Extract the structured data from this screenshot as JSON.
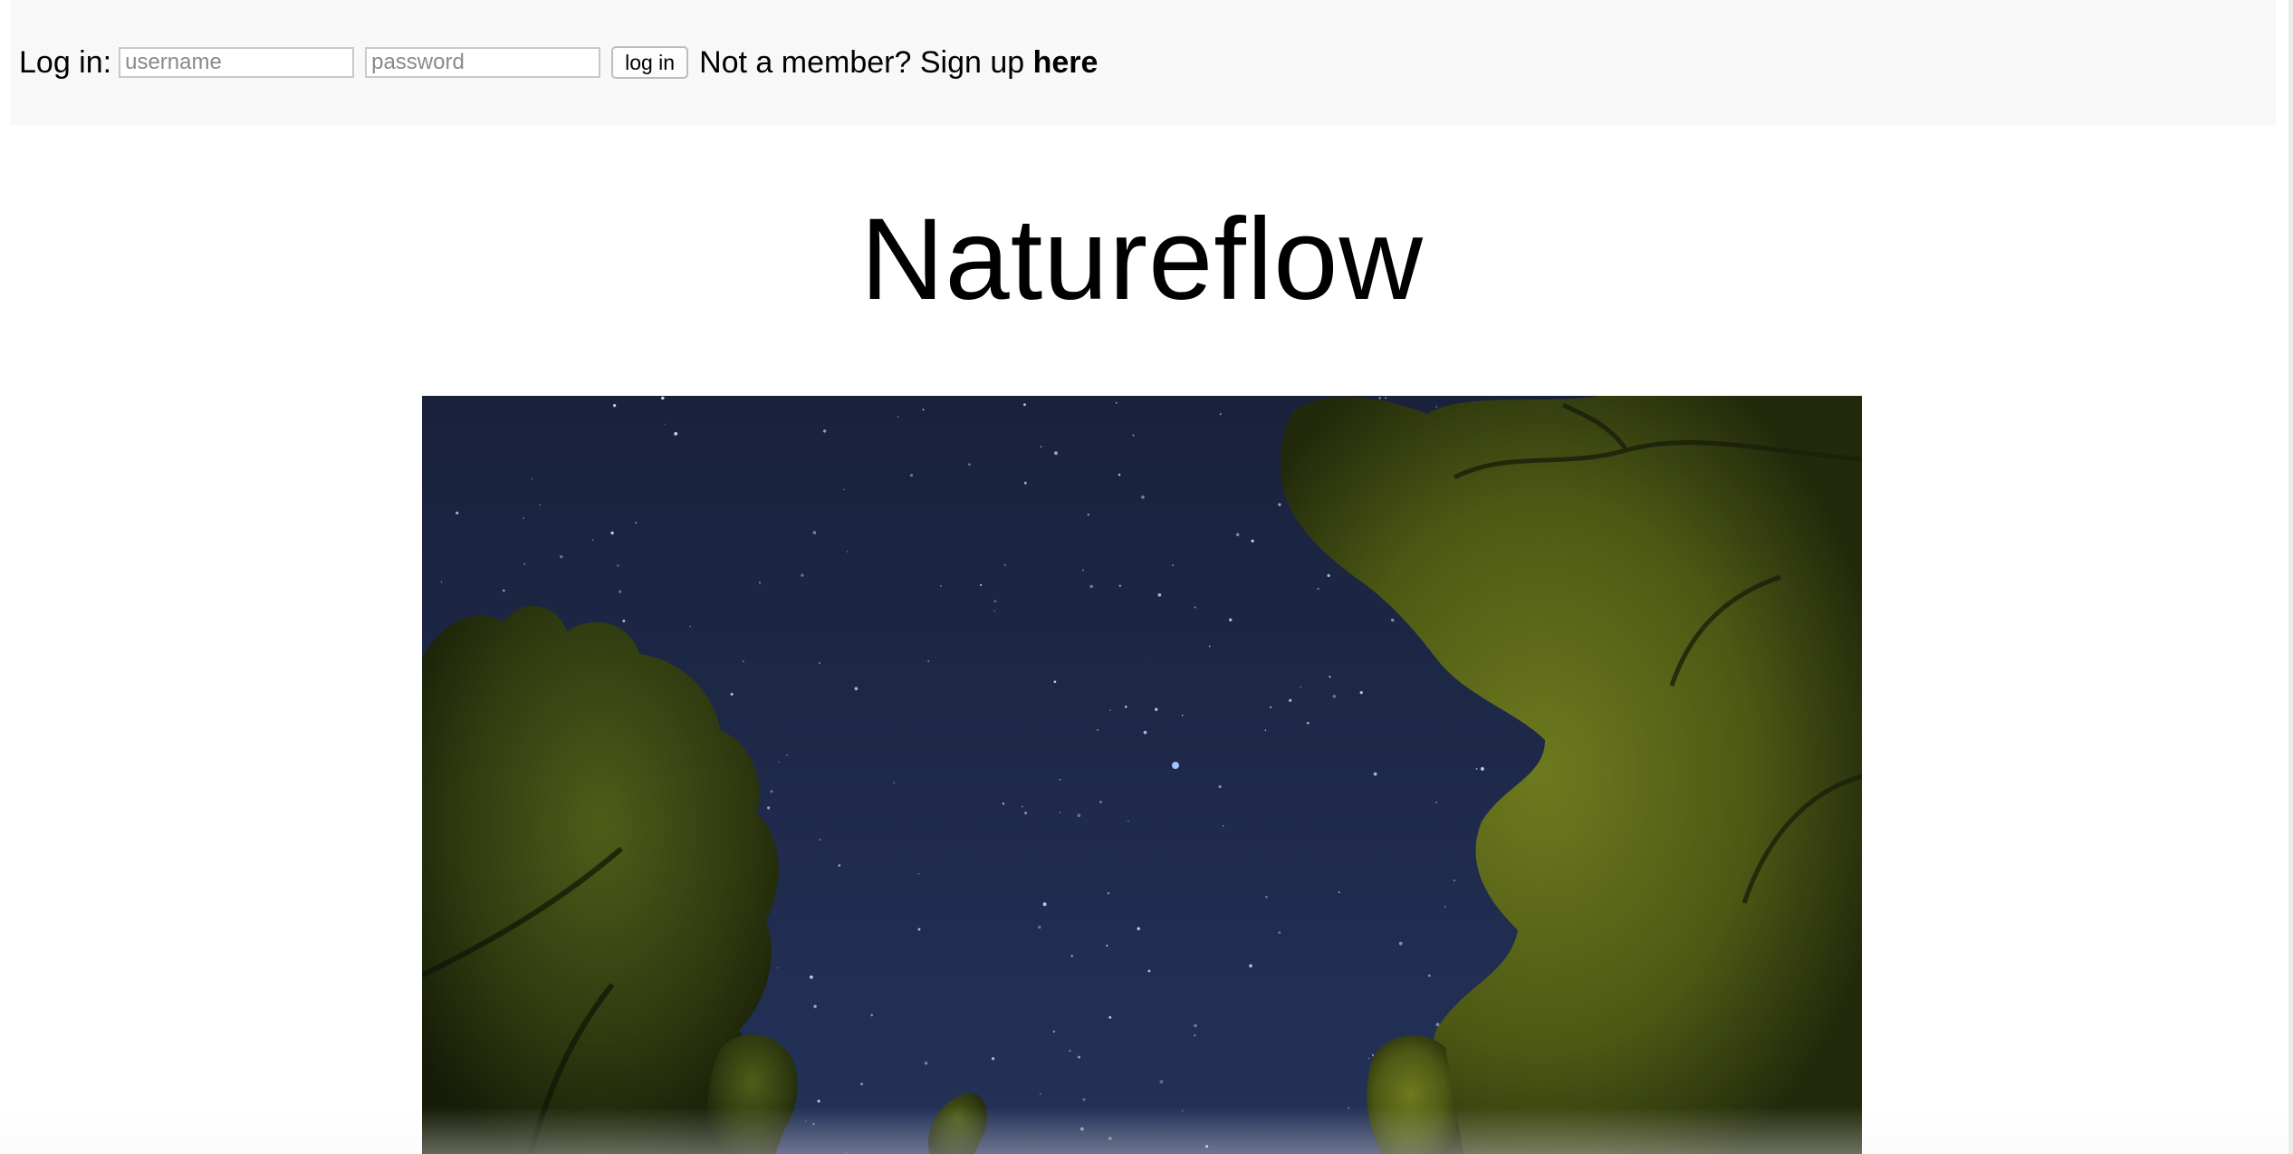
{
  "header": {
    "login_label": "Log in:",
    "username": {
      "value": "",
      "placeholder": "username"
    },
    "password": {
      "value": "",
      "placeholder": "password"
    },
    "login_button_label": "log in",
    "signup_prompt": "Not a member? Sign up",
    "signup_link_label": "here"
  },
  "main": {
    "site_title": "Natureflow",
    "hero_image_icon": "night-sky-through-trees-photo"
  },
  "colors": {
    "topbar_background": "#f8f8f8",
    "sky": "#1b2440",
    "foliage": "#4c5a16"
  }
}
